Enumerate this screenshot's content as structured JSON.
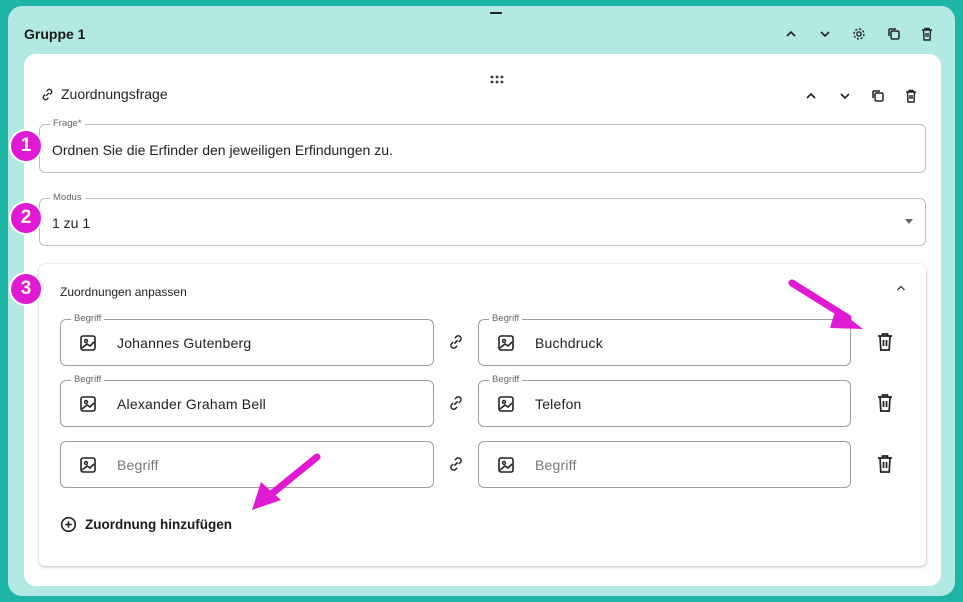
{
  "group": {
    "title": "Gruppe 1",
    "icons": [
      "chevron-up-icon",
      "chevron-down-icon",
      "gear-icon",
      "copy-icon",
      "trash-icon"
    ]
  },
  "question": {
    "type_label": "Zuordnungsfrage",
    "frage": {
      "legend": "Frage*",
      "value": "Ordnen Sie die Erfinder den jeweiligen Erfindungen zu."
    },
    "modus": {
      "legend": "Modus",
      "value": "1 zu 1"
    }
  },
  "mappings": {
    "title": "Zuordnungen anpassen",
    "rows": [
      {
        "left": {
          "legend": "Begriff",
          "value": "Johannes Gutenberg"
        },
        "right": {
          "legend": "Begriff",
          "value": "Buchdruck"
        }
      },
      {
        "left": {
          "legend": "Begriff",
          "value": "Alexander Graham Bell"
        },
        "right": {
          "legend": "Begriff",
          "value": "Telefon"
        }
      },
      {
        "left": {
          "legend": "",
          "placeholder": "Begriff"
        },
        "right": {
          "legend": "",
          "placeholder": "Begriff"
        }
      }
    ],
    "add_label": "Zuordnung hinzufügen"
  },
  "annotations": {
    "badges": [
      "1",
      "2",
      "3"
    ],
    "color": "#e01ad4"
  },
  "colors": {
    "background": "#1fb5a5",
    "group_panel": "#b3e9e3",
    "card": "#ffffff"
  }
}
